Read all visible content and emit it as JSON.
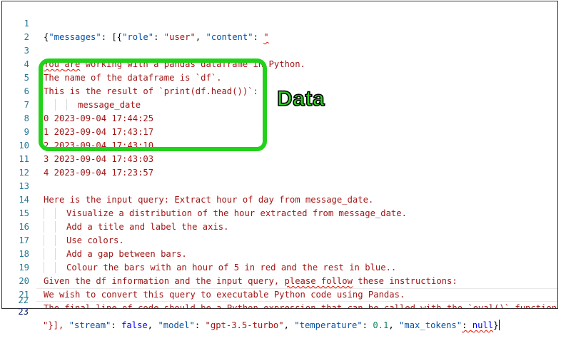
{
  "editor": {
    "lines": [
      {
        "num": "1"
      },
      {
        "num": "2",
        "text": ""
      },
      {
        "num": "3",
        "a": "You ",
        "b": "are",
        "c": " working with a pandas dataframe in Python."
      },
      {
        "num": "4",
        "a": "The name of the dataframe is `df`."
      },
      {
        "num": "5",
        "a": "This is the result of `print(df.head())`:"
      },
      {
        "num": "6",
        "text": "message_date"
      },
      {
        "num": "7",
        "text": "0 2023-09-04 17:44:25"
      },
      {
        "num": "8",
        "text": "1 2023-09-04 17:43:17"
      },
      {
        "num": "9",
        "text": "2 2023-09-04 17:43:10"
      },
      {
        "num": "10",
        "text": "3 2023-09-04 17:43:03"
      },
      {
        "num": "11",
        "text": "4 2023-09-04 17:23:57"
      },
      {
        "num": "12",
        "text": ""
      },
      {
        "num": "13",
        "text": "Here is the input query: Extract hour of day from message_date."
      },
      {
        "num": "14",
        "text": "Visualize a distribution of the hour extracted from message_date."
      },
      {
        "num": "15",
        "text": "Add a title and label the axis."
      },
      {
        "num": "16",
        "text": "Use colors."
      },
      {
        "num": "17",
        "text": "Add a gap between bars."
      },
      {
        "num": "18",
        "text": "Colour the bars with an hour of 5 in red and the rest in blue.."
      },
      {
        "num": "19",
        "a": "Given the df information and the input query, ",
        "b": "please follow",
        "c": " these instructions:"
      },
      {
        "num": "20",
        "text": "We wish to convert this query to executable Python code using Pandas."
      },
      {
        "num": "21",
        "text": "The final line of code should be a Python expression that can be called with the `eval()` function."
      },
      {
        "num": "22",
        "text": ""
      },
      {
        "num": "23"
      }
    ],
    "line1": {
      "open": "{",
      "messages_key": "\"messages\"",
      "colon1": ": [{",
      "role_key": "\"role\"",
      "colon2": ": ",
      "role_val": "\"user\"",
      "comma": ", ",
      "content_key": "\"content\"",
      "colon3": ": ",
      "content_open": "\""
    },
    "line23": {
      "close": "\"}], ",
      "stream_key": "\"stream\"",
      "colon1": ": ",
      "stream_val": "false",
      "comma1": ", ",
      "model_key": "\"model\"",
      "colon2": ": ",
      "model_val": "\"gpt-3.5-turbo\"",
      "comma2": ", ",
      "temp_key": "\"temperature\"",
      "colon3": ": ",
      "temp_val": "0.1",
      "comma3": ", ",
      "max_key": "\"max_tokens\"",
      "colon4": ": ",
      "max_val": "null",
      "end": "}"
    }
  },
  "annotation": {
    "label": "Data",
    "color": "#22d21a"
  }
}
